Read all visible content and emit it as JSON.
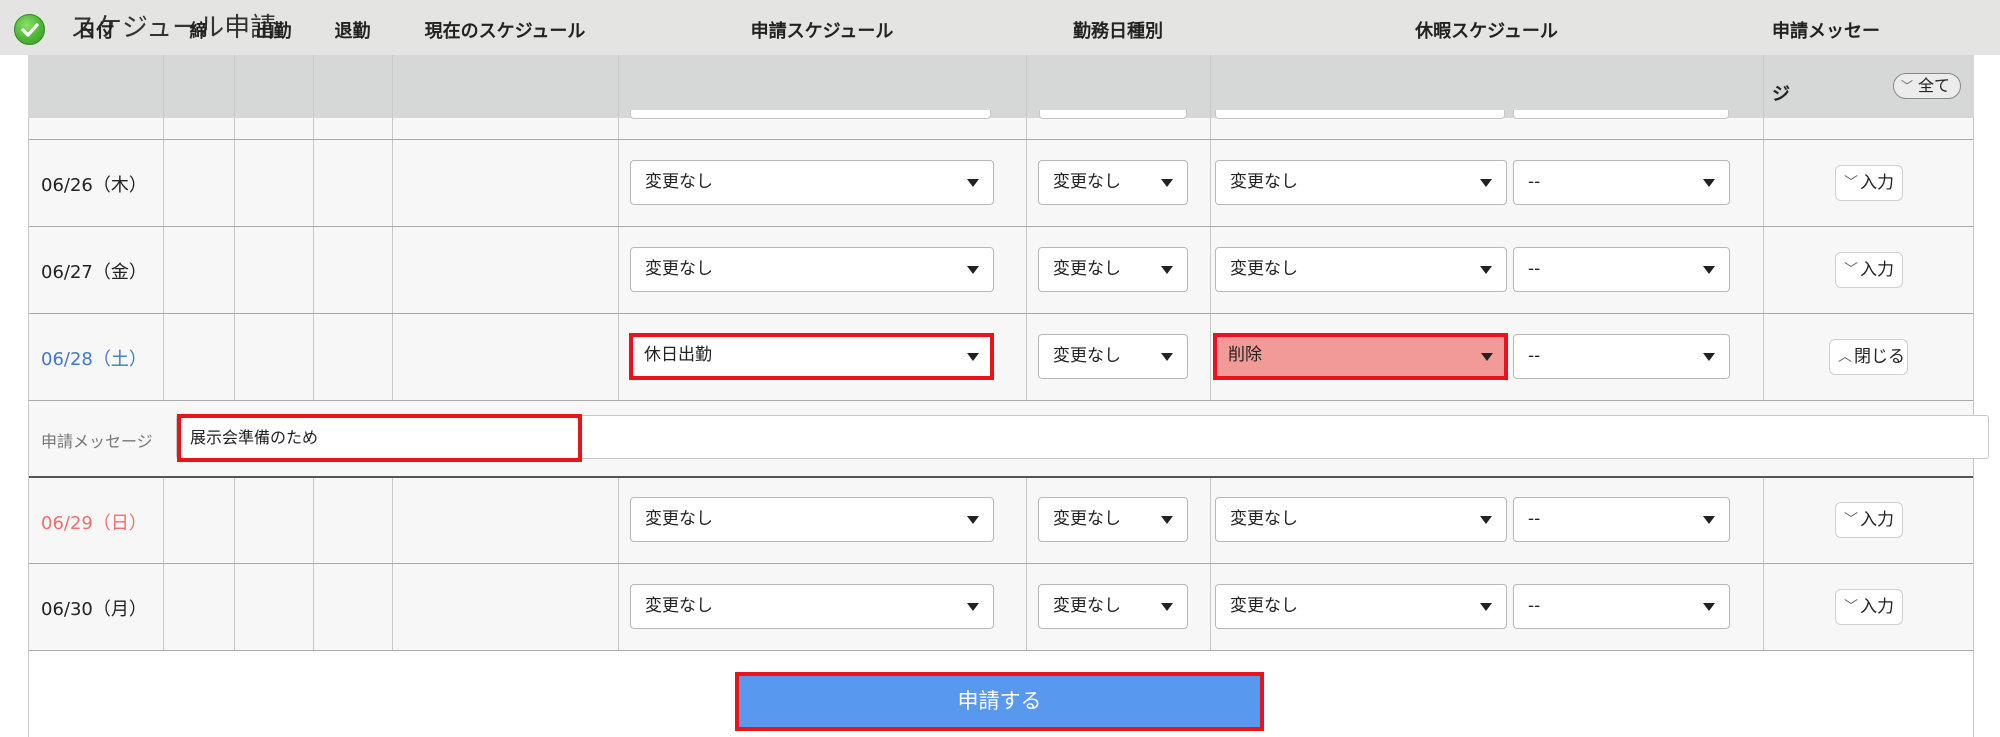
{
  "window": {
    "title": "スケジュール申請"
  },
  "columns": {
    "date": "日付",
    "close": "締",
    "clock_in": "出勤",
    "clock_out": "退勤",
    "current_schedule": "現在のスケジュール",
    "request_schedule": "申請スケジュール",
    "workday_type": "勤務日種別",
    "leave_schedule": "休暇スケジュール",
    "request_message": "申請メッセージ",
    "all_button": "全て"
  },
  "rows": [
    {
      "date": "06/26（木）",
      "request_schedule": "変更なし",
      "workday_type": "変更なし",
      "leave_schedule": "変更なし",
      "leave_sub": "--",
      "message_button": "入力"
    },
    {
      "date": "06/27（金）",
      "request_schedule": "変更なし",
      "workday_type": "変更なし",
      "leave_schedule": "変更なし",
      "leave_sub": "--",
      "message_button": "入力"
    },
    {
      "date": "06/28（土）",
      "request_schedule": "休日出勤",
      "workday_type": "変更なし",
      "leave_schedule": "削除",
      "leave_sub": "--",
      "message_button": "閉じる"
    },
    {
      "date": "06/29（日）",
      "request_schedule": "変更なし",
      "workday_type": "変更なし",
      "leave_schedule": "変更なし",
      "leave_sub": "--",
      "message_button": "入力"
    },
    {
      "date": "06/30（月）",
      "request_schedule": "変更なし",
      "workday_type": "変更なし",
      "leave_schedule": "変更なし",
      "leave_sub": "--",
      "message_button": "入力"
    }
  ],
  "message_row": {
    "label": "申請メッセージ",
    "value": "展示会準備のため"
  },
  "submit_label": "申請する",
  "colors": {
    "saturday": "#3f79c7",
    "sunday": "#f0706c",
    "highlight": "#e8141a",
    "submit": "#5998ef",
    "deleted_fill": "#f19a98"
  }
}
